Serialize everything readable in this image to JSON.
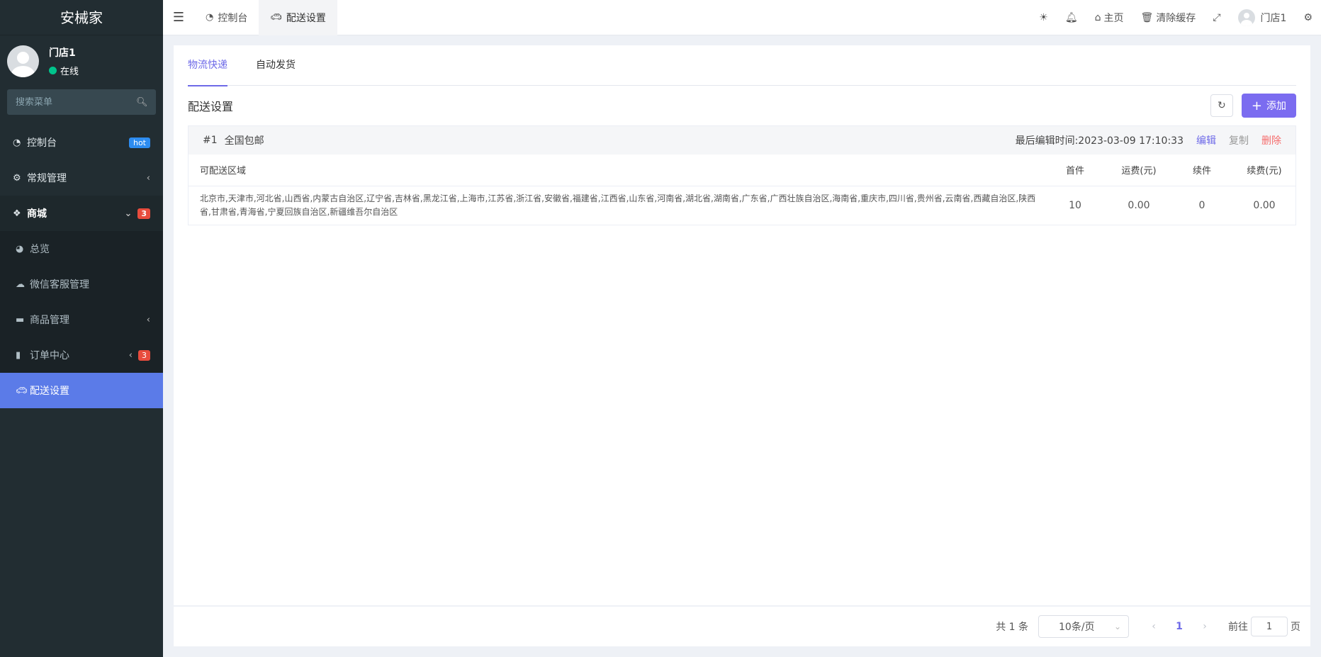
{
  "brand": "安械家",
  "user": {
    "name": "门店1",
    "status": "在线"
  },
  "menu_search": {
    "placeholder": "搜索菜单"
  },
  "sidebar": {
    "items": [
      {
        "label": "控制台",
        "badge": "hot"
      },
      {
        "label": "常规管理"
      },
      {
        "label": "商城",
        "badge": "3"
      },
      {
        "label": "总览"
      },
      {
        "label": "微信客服管理"
      },
      {
        "label": "商品管理"
      },
      {
        "label": "订单中心",
        "badge": "3"
      },
      {
        "label": "配送设置"
      }
    ]
  },
  "topbar": {
    "tabs": [
      "控制台",
      "配送设置"
    ],
    "home": "主页",
    "clear_cache": "清除缓存",
    "user": "门店1"
  },
  "content": {
    "tabs": [
      "物流快递",
      "自动发货"
    ],
    "section_title": "配送设置",
    "add_label": "添加",
    "card": {
      "number": "#1",
      "name": "全国包邮",
      "last_edit": "最后编辑时间:2023-03-09 17:10:33",
      "edit": "编辑",
      "copy": "复制",
      "delete": "删除",
      "columns": [
        "可配送区域",
        "首件",
        "运费(元)",
        "续件",
        "续费(元)"
      ],
      "row": {
        "area": "北京市,天津市,河北省,山西省,内蒙古自治区,辽宁省,吉林省,黑龙江省,上海市,江苏省,浙江省,安徽省,福建省,江西省,山东省,河南省,湖北省,湖南省,广东省,广西壮族自治区,海南省,重庆市,四川省,贵州省,云南省,西藏自治区,陕西省,甘肃省,青海省,宁夏回族自治区,新疆维吾尔自治区",
        "first": "10",
        "fee": "0.00",
        "extra": "0",
        "extra_fee": "0.00"
      }
    }
  },
  "pagination": {
    "total": "共 1 条",
    "page_size": "10条/页",
    "current": "1",
    "goto_prefix": "前往",
    "goto_value": "1",
    "goto_suffix": "页"
  },
  "colors": {
    "accent": "#7b6cf0",
    "sidebar": "#222d32",
    "active_menu": "#5b7be8"
  }
}
